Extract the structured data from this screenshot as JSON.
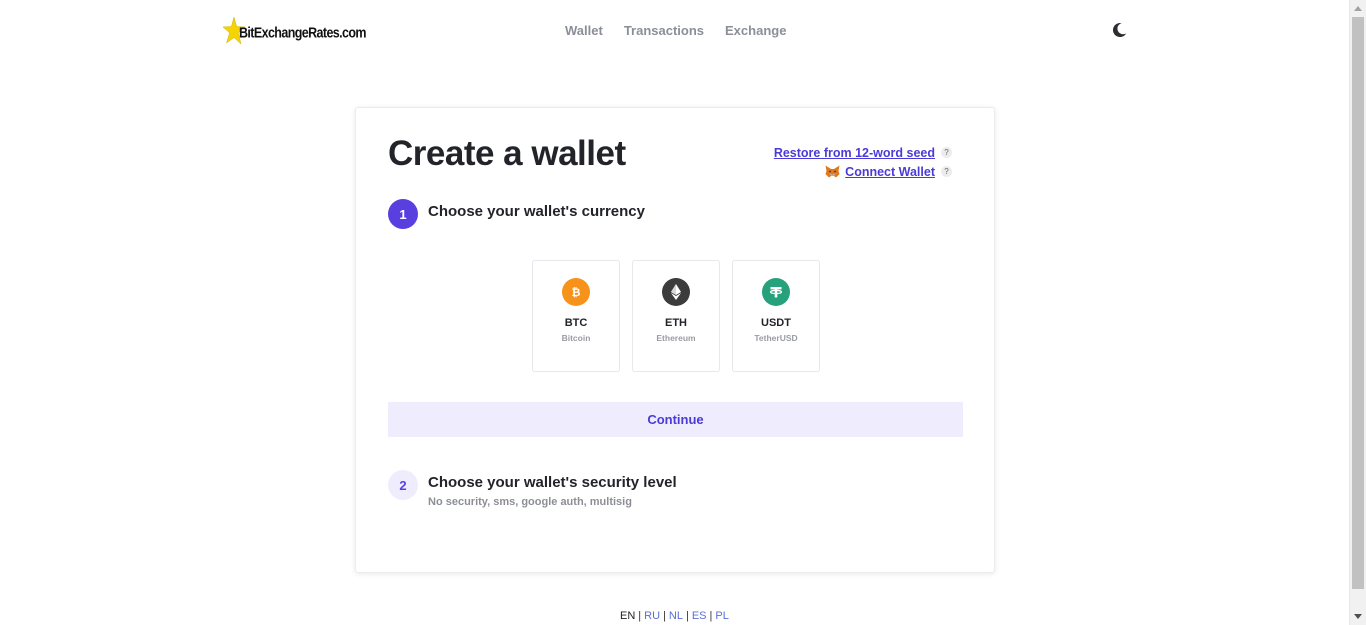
{
  "header": {
    "logo_text": "BitExchangeRates.com",
    "nav": [
      "Wallet",
      "Transactions",
      "Exchange"
    ],
    "theme_icon": "moon-icon"
  },
  "card": {
    "title": "Create a wallet",
    "restore_link": "Restore from 12-word seed",
    "connect_link": "Connect Wallet",
    "help_glyph": "?",
    "step1": {
      "number": "1",
      "title": "Choose your wallet's currency"
    },
    "currencies": [
      {
        "code": "BTC",
        "name": "Bitcoin",
        "color": "#f7931a",
        "icon": "bitcoin-icon"
      },
      {
        "code": "ETH",
        "name": "Ethereum",
        "color": "#3c3c3d",
        "icon": "ethereum-icon"
      },
      {
        "code": "USDT",
        "name": "TetherUSD",
        "color": "#26a17b",
        "icon": "tether-icon"
      }
    ],
    "continue_label": "Continue",
    "step2": {
      "number": "2",
      "title": "Choose your wallet's security level",
      "subtitle": "No security, sms, google auth, multisig"
    }
  },
  "languages": {
    "current": "EN",
    "others": [
      "RU",
      "NL",
      "ES",
      "PL"
    ],
    "separator": "|"
  },
  "colors": {
    "accent": "#5a3fe0",
    "link": "#4b3bd6",
    "accent_light": "#efedfd"
  }
}
